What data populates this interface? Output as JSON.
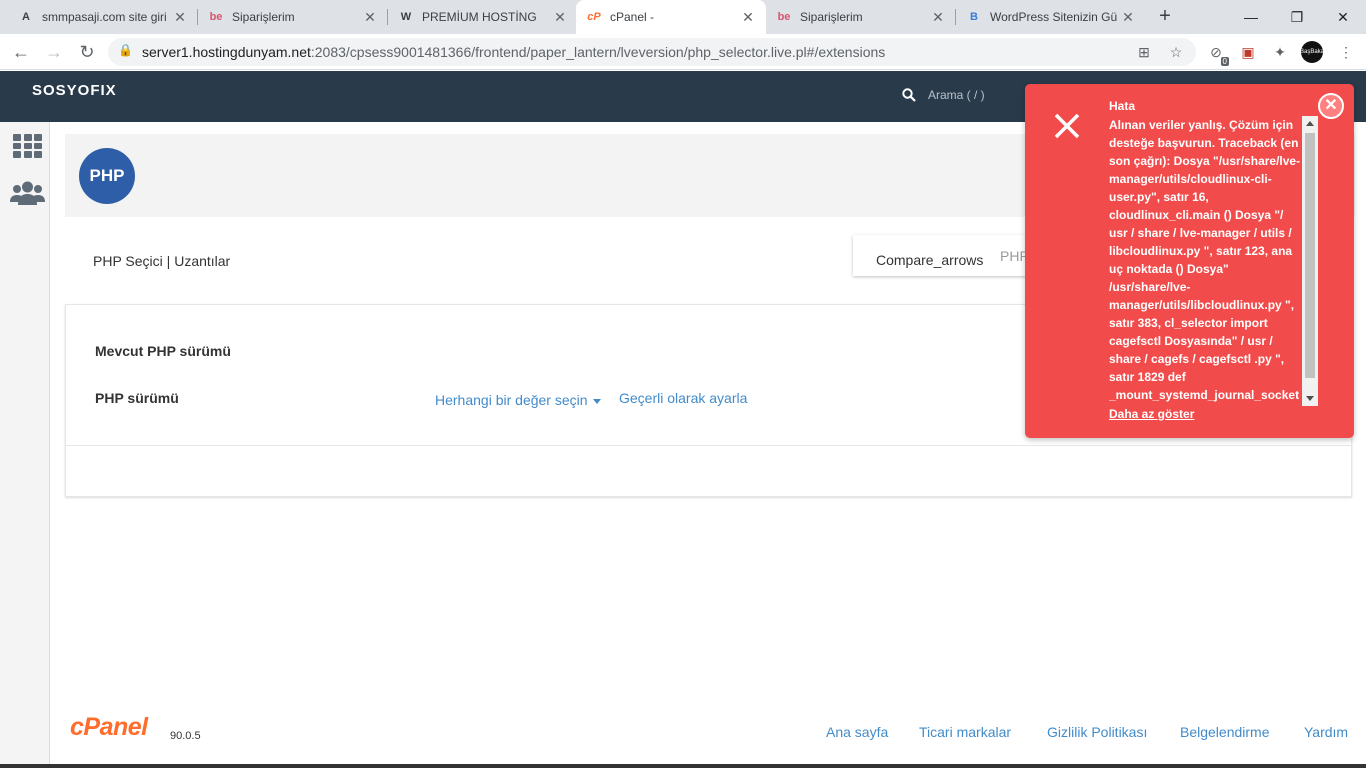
{
  "browser": {
    "tabs": [
      {
        "favicon": "A",
        "title": "smmpasaji.com site giri"
      },
      {
        "favicon": "be",
        "title": "Siparişlerim"
      },
      {
        "favicon": "W",
        "title": "PREMİUM HOSTİNG"
      },
      {
        "favicon": "cP",
        "title": "cPanel -"
      },
      {
        "favicon": "be",
        "title": "Siparişlerim"
      },
      {
        "favicon": "B",
        "title": "WordPress Sitenizin Gü"
      }
    ],
    "url_host": "server1.hostingdunyam.net",
    "url_path": ":2083/cpsess9001481366/frontend/paper_lantern/lveversion/php_selector.live.pl#/extensions",
    "ext_badge": "0",
    "profile_label": "BaşBaka"
  },
  "header": {
    "logo_text": "SOSYOFIX",
    "search_placeholder": "Arama ( / )"
  },
  "page": {
    "icon_label": "PHP",
    "breadcrumb_1": "PHP Seçici",
    "breadcrumb_sep": "|",
    "breadcrumb_2": "Uzantılar",
    "compare_label": "Compare_arrows",
    "compare_value": "PHP"
  },
  "panel": {
    "current_label": "Mevcut PHP sürümü",
    "version_label": "PHP sürümü",
    "select_label": "Herhangi bir değer seçin",
    "set_current_label": "Geçerli olarak ayarla"
  },
  "footer": {
    "logo": "cPanel",
    "version": "90.0.5",
    "links": [
      "Ana sayfa",
      "Ticari markalar",
      "Gizlilik Politikası",
      "Belgelendirme",
      "Yardım"
    ]
  },
  "toast": {
    "title": "Hata",
    "message": "Alınan veriler yanlış. Çözüm için desteğe başvurun. Traceback (en son çağrı): Dosya \"/usr/share/lve-manager/utils/cloudlinux-cli-user.py\", satır 16, cloudlinux_cli.main () Dosya \"/ usr / share / lve-manager / utils / libcloudlinux.py \", satır 123, ana uç noktada () Dosya\" /usr/share/lve-manager/utils/libcloudlinux.py \", satır 383, cl_selector import cagefsctl Dosyasında\" / usr / share / cagefs / cagefsctl .py \", satır 1829 def _mount_systemd_journal_socket",
    "show_less": "Daha az göster"
  },
  "colors": {
    "header_bg": "#293a4a",
    "toast_bg": "#f24b4b",
    "link": "#428bca",
    "cpanel_orange": "#ff6c2c"
  }
}
